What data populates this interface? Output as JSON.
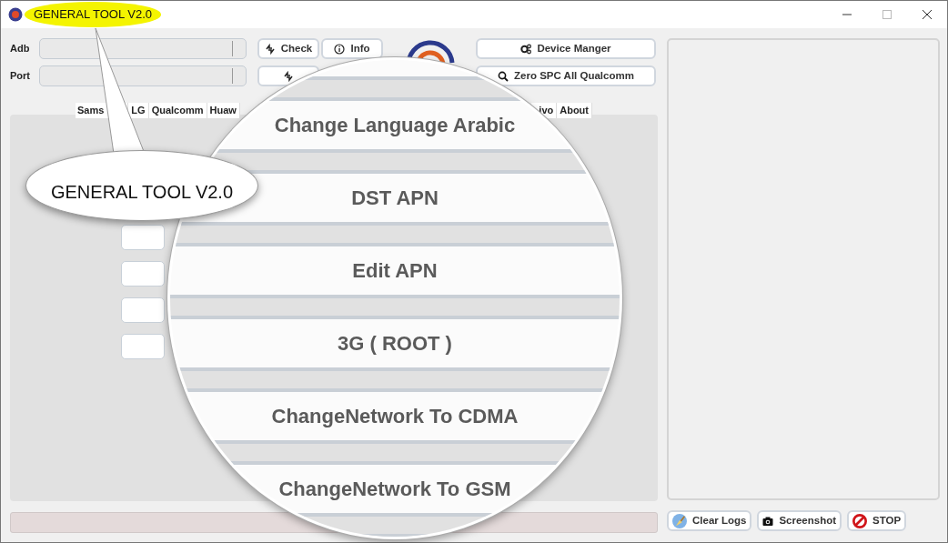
{
  "window": {
    "title": "GENERAL TOOL V2.0"
  },
  "connection": {
    "fields": [
      {
        "label": "Adb"
      },
      {
        "label": "Port"
      }
    ],
    "buttons": [
      {
        "label": "Check"
      },
      {
        "label": "Info"
      }
    ]
  },
  "actions": [
    {
      "label": "Device Manger"
    },
    {
      "label": "Zero SPC All Qualcomm"
    }
  ],
  "tabs": [
    {
      "label": "Sams"
    },
    {
      "label": "LG"
    },
    {
      "label": "Qualcomm"
    },
    {
      "label": "Huaw"
    },
    {
      "label": "ivo"
    },
    {
      "label": "About"
    }
  ],
  "panel_buttons": [
    {
      "kind": "blank"
    },
    {
      "kind": "blank"
    },
    {
      "kind": "blank"
    },
    {
      "kind": "blank"
    }
  ],
  "progress": {
    "level": 0
  },
  "log_buttons": [
    {
      "label": "Clear Logs"
    },
    {
      "label": "Screenshot"
    },
    {
      "label": "STOP"
    }
  ],
  "callout": {
    "text": "GENERAL TOOL V2.0"
  },
  "magnifier": {
    "items": [
      "Change Language Arabic",
      "DST APN",
      "Edit APN",
      "3G ( ROOT )",
      "ChangeNetwork To CDMA",
      "ChangeNetwork To GSM"
    ]
  }
}
